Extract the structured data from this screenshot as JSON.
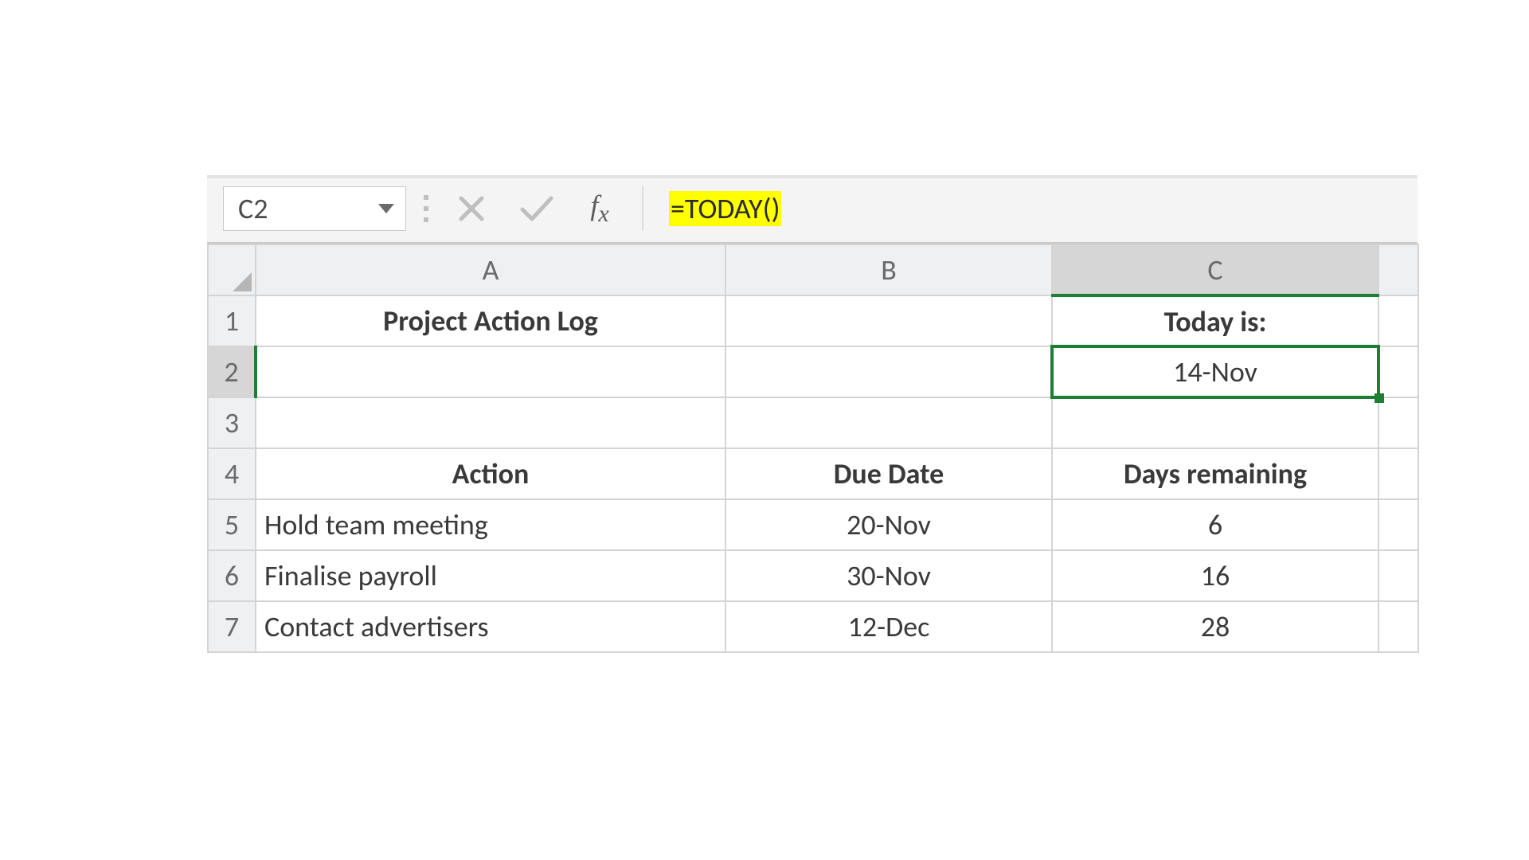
{
  "formula_bar": {
    "cell_ref": "C2",
    "formula": "=TODAY()"
  },
  "columns": [
    "A",
    "B",
    "C"
  ],
  "row_numbers": [
    "1",
    "2",
    "3",
    "4",
    "5",
    "6",
    "7"
  ],
  "selected_cell": "C2",
  "cells": {
    "A1": "Project Action Log",
    "C1": "Today is:",
    "C2": "14-Nov",
    "A4": "Action",
    "B4": "Due Date",
    "C4": "Days remaining",
    "A5": "Hold team meeting",
    "B5": "20-Nov",
    "C5": "6",
    "A6": "Finalise payroll",
    "B6": "30-Nov",
    "C6": "16",
    "A7": "Contact advertisers",
    "B7": "12-Dec",
    "C7": "28"
  },
  "chart_data": {
    "type": "table",
    "title": "Project Action Log",
    "today": "14-Nov",
    "columns": [
      "Action",
      "Due Date",
      "Days remaining"
    ],
    "rows": [
      [
        "Hold team meeting",
        "20-Nov",
        6
      ],
      [
        "Finalise payroll",
        "30-Nov",
        16
      ],
      [
        "Contact advertisers",
        "12-Dec",
        28
      ]
    ]
  }
}
